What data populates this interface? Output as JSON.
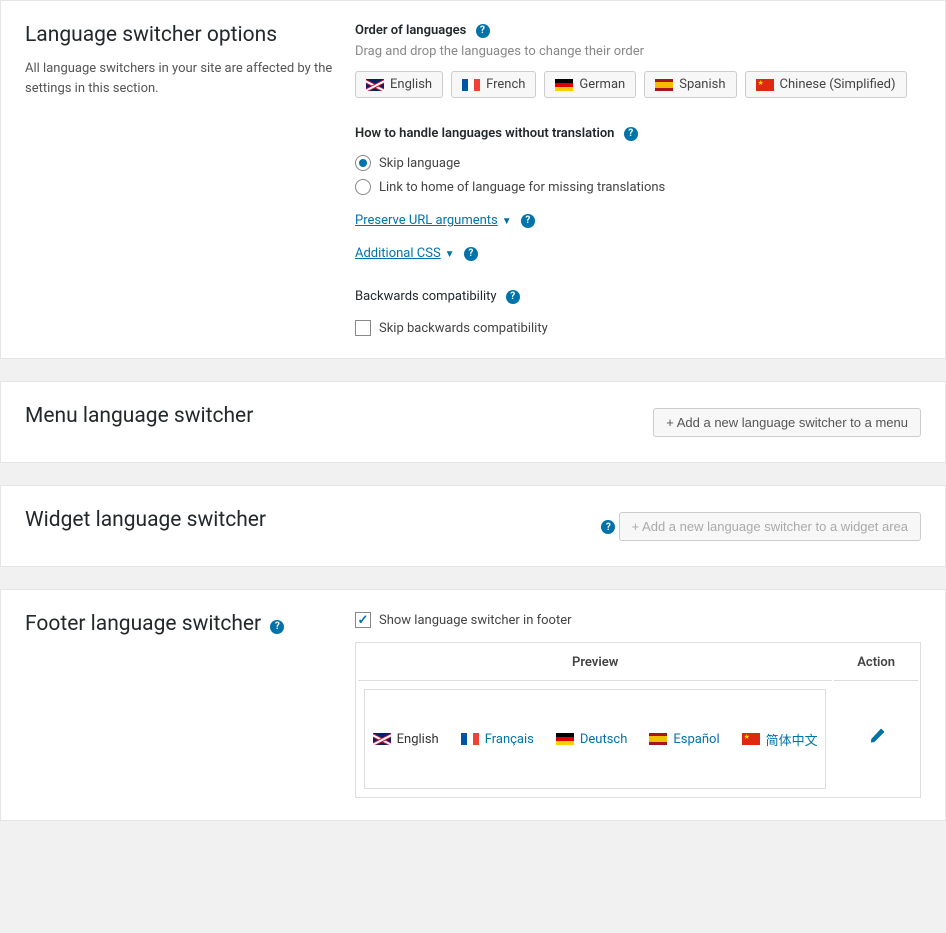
{
  "switcher_options": {
    "title": "Language switcher options",
    "description": "All language switchers in your site are affected by the settings in this section.",
    "order_label": "Order of languages",
    "order_subtext": "Drag and drop the languages to change their order",
    "languages": [
      {
        "code": "en",
        "label": "English",
        "flag": "uk"
      },
      {
        "code": "fr",
        "label": "French",
        "flag": "fr"
      },
      {
        "code": "de",
        "label": "German",
        "flag": "de"
      },
      {
        "code": "es",
        "label": "Spanish",
        "flag": "es"
      },
      {
        "code": "zh",
        "label": "Chinese (Simplified)",
        "flag": "cn"
      }
    ],
    "handle_label": "How to handle languages without translation",
    "radio_skip": "Skip language",
    "radio_home": "Link to home of language for missing translations",
    "preserve_url": "Preserve URL arguments",
    "additional_css": "Additional CSS",
    "backcompat_label": "Backwards compatibility",
    "skip_backcompat": "Skip backwards compatibility"
  },
  "menu_switcher": {
    "title": "Menu language switcher",
    "add_button": "+ Add a new language switcher to a menu"
  },
  "widget_switcher": {
    "title": "Widget language switcher",
    "add_button": "+ Add a new language switcher to a widget area"
  },
  "footer_switcher": {
    "title": "Footer language switcher",
    "show_label": "Show language switcher in footer",
    "preview_header": "Preview",
    "action_header": "Action",
    "preview_languages": [
      {
        "label": "English",
        "flag": "uk",
        "current": true
      },
      {
        "label": "Français",
        "flag": "fr"
      },
      {
        "label": "Deutsch",
        "flag": "de"
      },
      {
        "label": "Español",
        "flag": "es"
      },
      {
        "label": "简体中文",
        "flag": "cn"
      }
    ]
  }
}
